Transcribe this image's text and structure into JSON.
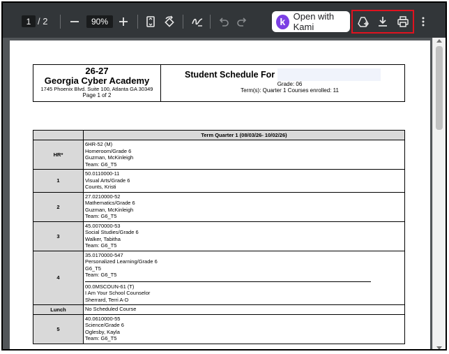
{
  "toolbar": {
    "page_current": "1",
    "page_total": "/  2",
    "zoom": "90%",
    "kami_button": "Open with Kami",
    "kami_logo": "k"
  },
  "document": {
    "year": "26-27",
    "school": "Georgia Cyber Academy",
    "address": "1745 Phoenix Blvd. Suite 100, Atlanta  GA 30349",
    "page_label": "Page 1 of  2",
    "title": "Student Schedule For",
    "grade": "Grade: 06",
    "term_info": "Term(s): Quarter 1 Courses enrolled: 11"
  },
  "schedule": {
    "term_header": "Term Quarter 1 (08/03/26- 10/02/26)",
    "rows": [
      {
        "period": "HR*",
        "lines": [
          "6HR-52 (M)",
          "Homeroom/Grade 6",
          "Guzman, McKinleigh",
          "Team: G6_T5"
        ],
        "sub": []
      },
      {
        "period": "1",
        "lines": [
          "50.0110000-11",
          "Visual Arts/Grade 6",
          "Counts, Kristi"
        ],
        "sub": []
      },
      {
        "period": "2",
        "lines": [
          "27.0210000-52",
          "Mathematics/Grade 6",
          "Guzman, McKinleigh",
          "Team: G6_T5"
        ],
        "sub": []
      },
      {
        "period": "3",
        "lines": [
          "45.0070000-53",
          "Social Studies/Grade 6",
          "Walker, Tabitha",
          "Team: G6_T5"
        ],
        "sub": []
      },
      {
        "period": "4",
        "lines": [
          "35.0170000-547",
          "Personalized Learning/Grade 6",
          "G6_T5",
          "Team: G6_T5"
        ],
        "sub": [
          "00.0MSCOUN-61 (T)",
          "I Am Your School Counselor",
          "Sherrard, Terri A-D"
        ]
      },
      {
        "period": "Lunch",
        "lines": [
          "No Scheduled Course"
        ],
        "sub": []
      },
      {
        "period": "5",
        "lines": [
          "40.0610000-55",
          "Science/Grade 6",
          "Oglesby, Kayla",
          "Team: G6_T5"
        ],
        "sub": []
      }
    ]
  }
}
